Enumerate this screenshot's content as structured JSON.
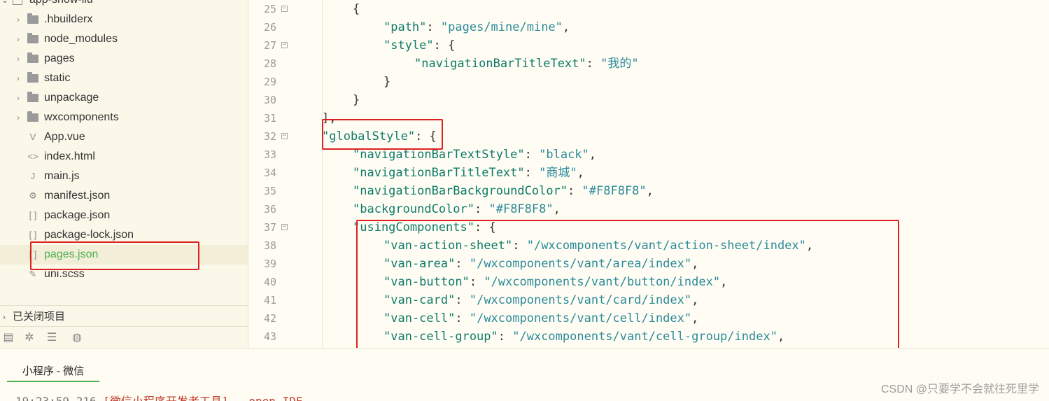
{
  "explorer": {
    "root_label": "app-show-liu",
    "items": [
      {
        "label": ".hbuilderx",
        "kind": "folder",
        "icon": "folder-icon"
      },
      {
        "label": "node_modules",
        "kind": "folder",
        "icon": "folder-icon"
      },
      {
        "label": "pages",
        "kind": "folder",
        "icon": "folder-icon"
      },
      {
        "label": "static",
        "kind": "folder",
        "icon": "folder-icon"
      },
      {
        "label": "unpackage",
        "kind": "folder",
        "icon": "folder-icon"
      },
      {
        "label": "wxcomponents",
        "kind": "folder",
        "icon": "folder-icon"
      },
      {
        "label": "App.vue",
        "kind": "file",
        "icon": "vue-file-icon",
        "glyph": "V"
      },
      {
        "label": "index.html",
        "kind": "file",
        "icon": "html-file-icon",
        "glyph": "<>"
      },
      {
        "label": "main.js",
        "kind": "file",
        "icon": "js-file-icon",
        "glyph": "J"
      },
      {
        "label": "manifest.json",
        "kind": "file",
        "icon": "manifest-file-icon",
        "glyph": "⚙"
      },
      {
        "label": "package.json",
        "kind": "file",
        "icon": "json-file-icon",
        "glyph": "[ ]"
      },
      {
        "label": "package-lock.json",
        "kind": "file",
        "icon": "json-file-icon",
        "glyph": "[ ]"
      },
      {
        "label": "pages.json",
        "kind": "file",
        "icon": "json-file-icon",
        "glyph": "[ ]",
        "selected": true
      },
      {
        "label": "uni.scss",
        "kind": "file",
        "icon": "scss-file-icon",
        "glyph": "✎"
      }
    ],
    "closed_projects_label": "已关闭项目",
    "toolbar_icons": [
      "project-manager-icon",
      "debug-icon",
      "search-files-icon",
      "browser-icon"
    ]
  },
  "editor": {
    "lines": [
      {
        "n": "25",
        "fold": true,
        "indent": 4,
        "tokens": [
          [
            "p",
            "{"
          ]
        ]
      },
      {
        "n": "26",
        "fold": false,
        "indent": 5,
        "tokens": [
          [
            "k",
            "\"path\""
          ],
          [
            "p",
            ": "
          ],
          [
            "s",
            "\"pages/mine/mine\""
          ],
          [
            "p",
            ","
          ]
        ]
      },
      {
        "n": "27",
        "fold": true,
        "indent": 5,
        "tokens": [
          [
            "k",
            "\"style\""
          ],
          [
            "p",
            ": {"
          ]
        ]
      },
      {
        "n": "28",
        "fold": false,
        "indent": 6,
        "tokens": [
          [
            "k",
            "\"navigationBarTitleText\""
          ],
          [
            "p",
            ": "
          ],
          [
            "s",
            "\"我的\""
          ]
        ]
      },
      {
        "n": "29",
        "fold": false,
        "indent": 5,
        "tokens": [
          [
            "p",
            "}"
          ]
        ]
      },
      {
        "n": "30",
        "fold": false,
        "indent": 4,
        "tokens": [
          [
            "p",
            "}"
          ]
        ]
      },
      {
        "n": "31",
        "fold": false,
        "indent": 3,
        "tokens": [
          [
            "p",
            "],"
          ]
        ]
      },
      {
        "n": "32",
        "fold": true,
        "indent": 3,
        "tokens": [
          [
            "k",
            "\"globalStyle\""
          ],
          [
            "p",
            ": {"
          ]
        ]
      },
      {
        "n": "33",
        "fold": false,
        "indent": 4,
        "tokens": [
          [
            "k",
            "\"navigationBarTextStyle\""
          ],
          [
            "p",
            ": "
          ],
          [
            "s",
            "\"black\""
          ],
          [
            "p",
            ","
          ]
        ]
      },
      {
        "n": "34",
        "fold": false,
        "indent": 4,
        "tokens": [
          [
            "k",
            "\"navigationBarTitleText\""
          ],
          [
            "p",
            ": "
          ],
          [
            "s",
            "\"商城\""
          ],
          [
            "p",
            ","
          ]
        ]
      },
      {
        "n": "35",
        "fold": false,
        "indent": 4,
        "tokens": [
          [
            "k",
            "\"navigationBarBackgroundColor\""
          ],
          [
            "p",
            ": "
          ],
          [
            "s",
            "\"#F8F8F8\""
          ],
          [
            "p",
            ","
          ]
        ]
      },
      {
        "n": "36",
        "fold": false,
        "indent": 4,
        "tokens": [
          [
            "k",
            "\"backgroundColor\""
          ],
          [
            "p",
            ": "
          ],
          [
            "s",
            "\"#F8F8F8\""
          ],
          [
            "p",
            ","
          ]
        ]
      },
      {
        "n": "37",
        "fold": true,
        "indent": 4,
        "tokens": [
          [
            "k",
            "\"usingComponents\""
          ],
          [
            "p",
            ": {"
          ]
        ]
      },
      {
        "n": "38",
        "fold": false,
        "indent": 5,
        "tokens": [
          [
            "k",
            "\"van-action-sheet\""
          ],
          [
            "p",
            ": "
          ],
          [
            "s",
            "\"/wxcomponents/vant/action-sheet/index\""
          ],
          [
            "p",
            ","
          ]
        ]
      },
      {
        "n": "39",
        "fold": false,
        "indent": 5,
        "tokens": [
          [
            "k",
            "\"van-area\""
          ],
          [
            "p",
            ": "
          ],
          [
            "s",
            "\"/wxcomponents/vant/area/index\""
          ],
          [
            "p",
            ","
          ]
        ]
      },
      {
        "n": "40",
        "fold": false,
        "indent": 5,
        "tokens": [
          [
            "k",
            "\"van-button\""
          ],
          [
            "p",
            ": "
          ],
          [
            "s",
            "\"/wxcomponents/vant/button/index\""
          ],
          [
            "p",
            ","
          ]
        ]
      },
      {
        "n": "41",
        "fold": false,
        "indent": 5,
        "tokens": [
          [
            "k",
            "\"van-card\""
          ],
          [
            "p",
            ": "
          ],
          [
            "s",
            "\"/wxcomponents/vant/card/index\""
          ],
          [
            "p",
            ","
          ]
        ]
      },
      {
        "n": "42",
        "fold": false,
        "indent": 5,
        "tokens": [
          [
            "k",
            "\"van-cell\""
          ],
          [
            "p",
            ": "
          ],
          [
            "s",
            "\"/wxcomponents/vant/cell/index\""
          ],
          [
            "p",
            ","
          ]
        ]
      },
      {
        "n": "43",
        "fold": false,
        "indent": 5,
        "tokens": [
          [
            "k",
            "\"van-cell-group\""
          ],
          [
            "p",
            ": "
          ],
          [
            "s",
            "\"/wxcomponents/vant/cell-group/index\""
          ],
          [
            "p",
            ","
          ]
        ]
      }
    ]
  },
  "console": {
    "tab_label": "小程序 - 微信",
    "line_timestamp": "19:23:59.216",
    "line_text": "[微信小程序开发者工具] - open IDE"
  },
  "watermark": "CSDN @只要学不会就往死里学",
  "colors": {
    "accent_green": "#4caf50",
    "annotation_red": "#e02020",
    "key_color": "#0e7a6b",
    "string_color": "#2b8a9a"
  }
}
